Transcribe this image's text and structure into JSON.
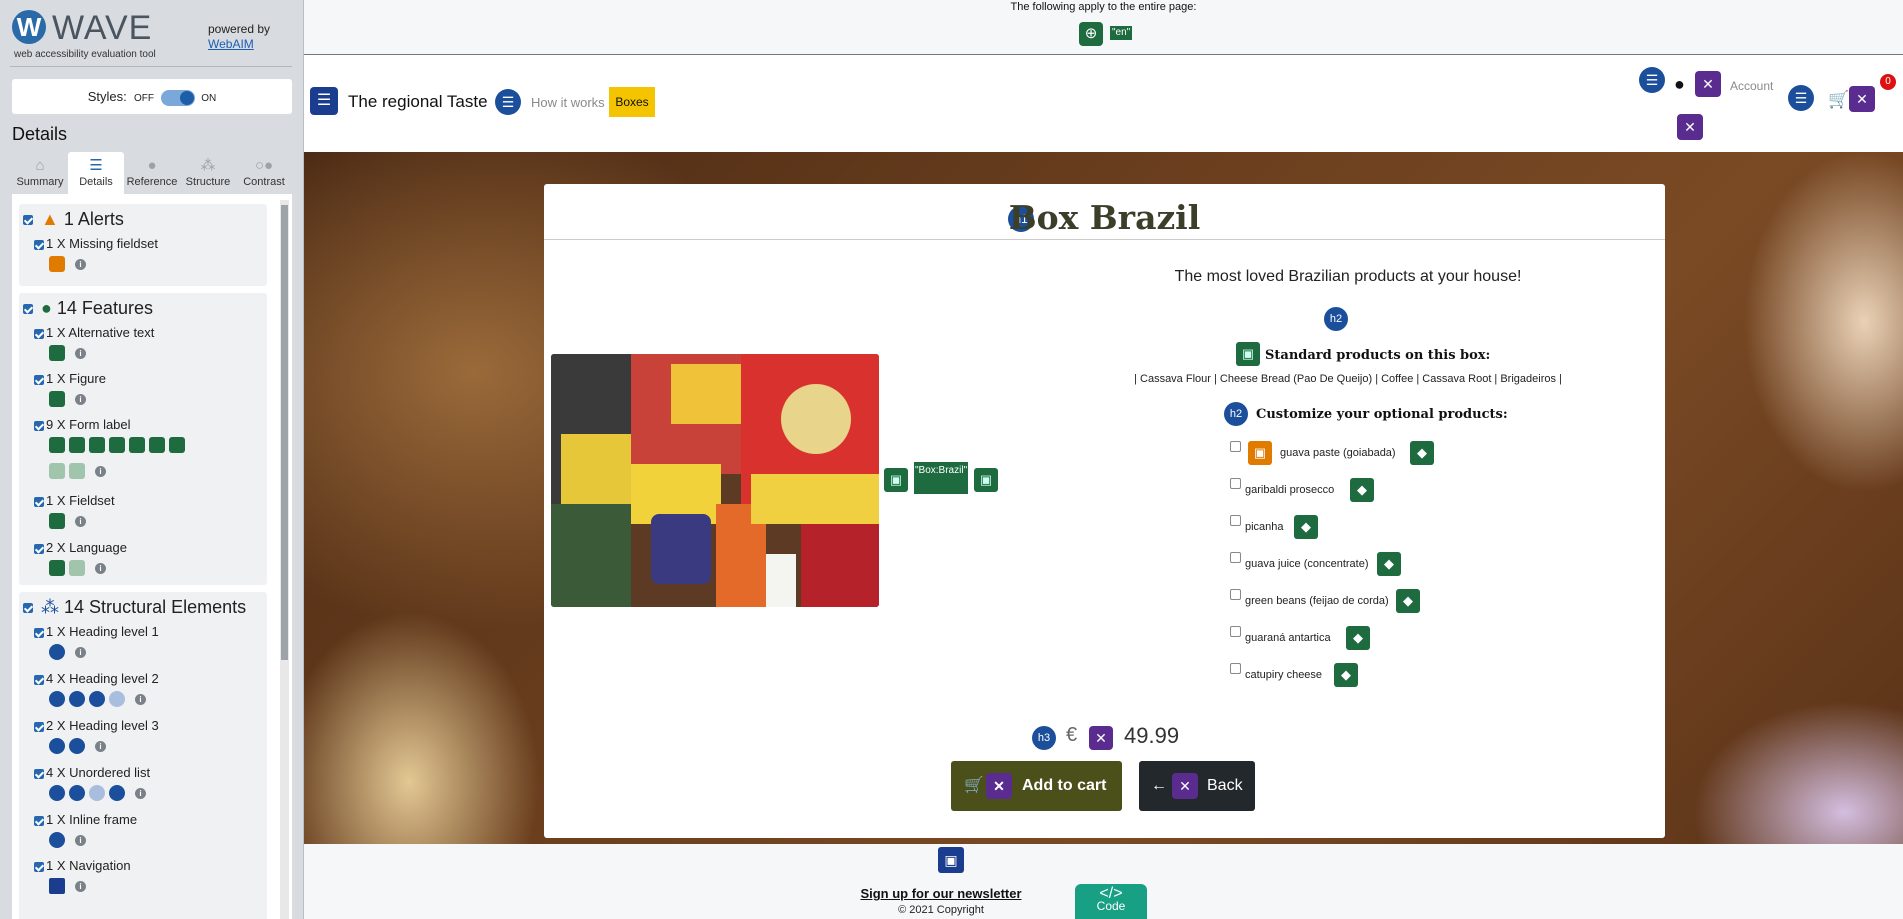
{
  "sidebar": {
    "logo_letter": "W",
    "logo_name": "WAVE",
    "logo_sub": "web accessibility evaluation tool",
    "powered_by": "powered by",
    "powered_link": "WebAIM",
    "styles_label": "Styles:",
    "styles_off": "OFF",
    "styles_on": "ON",
    "details_title": "Details",
    "tabs": [
      {
        "label": "Summary",
        "icon": "home-icon"
      },
      {
        "label": "Details",
        "icon": "list-icon"
      },
      {
        "label": "Reference",
        "icon": "info-icon"
      },
      {
        "label": "Structure",
        "icon": "sitemap-icon"
      },
      {
        "label": "Contrast",
        "icon": "contrast-icon"
      }
    ],
    "alerts": {
      "title": "1 Alerts",
      "items": [
        "1 X Missing fieldset"
      ]
    },
    "features": {
      "title": "14 Features",
      "items": [
        "1 X Alternative text",
        "1 X Figure",
        "9 X Form label",
        "1 X Fieldset",
        "2 X Language"
      ]
    },
    "structure": {
      "title": "14 Structural Elements",
      "items": [
        "1 X Heading level 1",
        "4 X Heading level 2",
        "2 X Heading level 3",
        "4 X Unordered list",
        "1 X Inline frame",
        "1 X Navigation"
      ]
    },
    "colors": {
      "accent": "#2667b0",
      "feature": "#1d6b3f",
      "alert": "#e07b00",
      "structure": "#1b4f9c"
    }
  },
  "page": {
    "apply_text": "The following apply to the entire page:",
    "lang_tag": "\"en\"",
    "brand": "The regional Taste",
    "nav_how": "How it works",
    "nav_boxes": "Boxes",
    "account": "Account",
    "cart_count": "0",
    "product": {
      "title": "Box Brazil",
      "tagline": "The most loved Brazilian products at your house!",
      "alt_tag": "\"Box:Brazil\"",
      "standard_heading": "Standard products on this box:",
      "standard_list": "| Cassava Flour | Cheese Bread (Pao De Queijo) | Coffee | Cassava Root | Brigadeiros |",
      "customize_heading": "Customize your optional products:",
      "options": [
        "guava paste (goiabada)",
        "garibaldi prosecco",
        "picanha",
        "guava juice (concentrate)",
        "green beans (feijao de corda)",
        "guaraná antartica",
        "catupiry cheese"
      ],
      "currency": "€",
      "price": "49.99",
      "add_to_cart": "Add to cart",
      "back": "Back"
    },
    "footer": {
      "newsletter": "Sign up for our newsletter",
      "copyright": "© 2021 Copyright",
      "code_symbol": "</>",
      "code_label": "Code"
    },
    "badges": {
      "h1": "h1",
      "h2": "h2",
      "h3": "h3"
    }
  }
}
